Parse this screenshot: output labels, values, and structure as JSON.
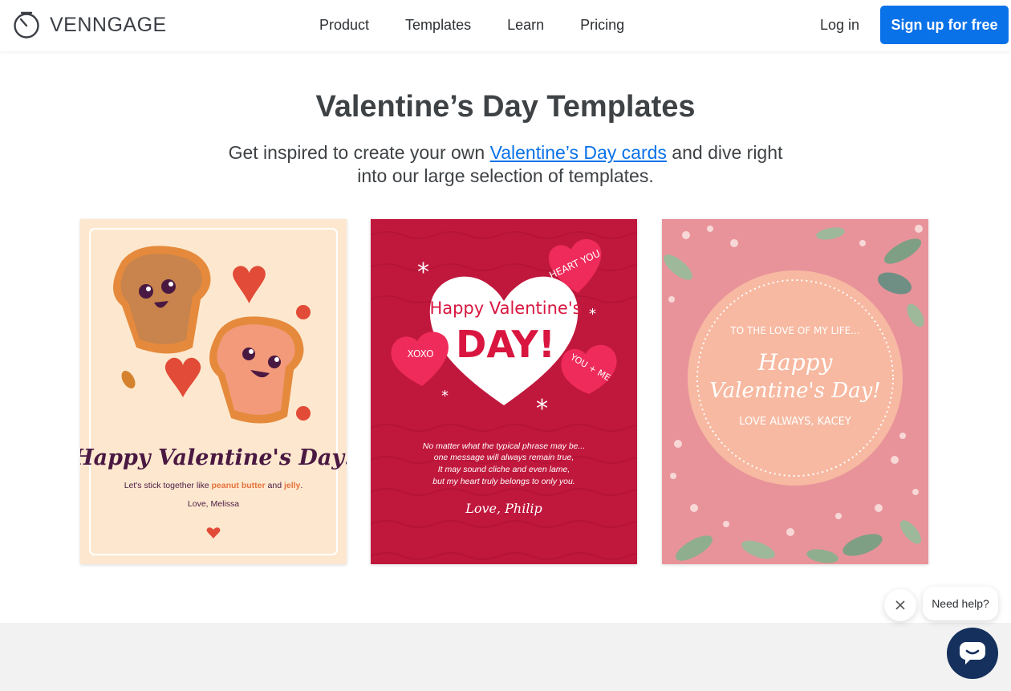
{
  "header": {
    "brand": "VENNGAGE",
    "nav": [
      "Product",
      "Templates",
      "Learn",
      "Pricing"
    ],
    "login_label": "Log in",
    "signup_label": "Sign up for free"
  },
  "hero": {
    "title": "Valentine’s Day Templates",
    "subtitle_before": "Get inspired to create your own ",
    "subtitle_link": "Valentine’s Day cards",
    "subtitle_after": " and dive right into our large selection of templates."
  },
  "cards": [
    {
      "title": "Happy Valentine's Day!",
      "line_before": "Let's stick together like ",
      "highlight_1": "peanut butter",
      "line_middle": " and ",
      "highlight_2": "jelly",
      "line_after": ".",
      "signature": "Love, Melissa",
      "colors": {
        "background": "#fde8cf",
        "title": "#4a1942",
        "highlight": "#e5733f"
      }
    },
    {
      "title_line1": "Happy Valentine's",
      "title_line2": "DAY!",
      "hearts": [
        "HEART YOU",
        "XOXO",
        "YOU + ME"
      ],
      "poem": [
        "No matter what the typical phrase may be...",
        "one message will always remain true,",
        "It may sound cliche and even lame,",
        "but my heart truly belongs to only you."
      ],
      "signature": "Love, Philip",
      "colors": {
        "background": "#c0183d",
        "heart": "#ffffff",
        "accent": "#ef2b5b"
      }
    },
    {
      "eyebrow": "TO THE LOVE OF MY LIFE...",
      "title_line1": "Happy",
      "title_line2": "Valentine's Day!",
      "signature": "LOVE ALWAYS, KACEY",
      "colors": {
        "background": "#e8939a",
        "circle": "#f7b9a1"
      }
    }
  ],
  "chat": {
    "help_label": "Need help?"
  },
  "icons": {
    "logo": "venngage-logo-icon",
    "close": "close-icon",
    "chat": "chat-icon"
  },
  "colors": {
    "primary": "#0a72e8",
    "text": "#3e4245",
    "chat": "#15305c"
  }
}
